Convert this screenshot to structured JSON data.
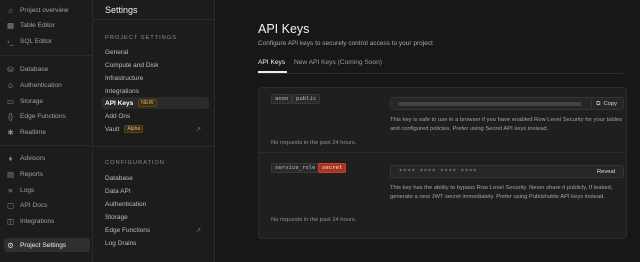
{
  "nav": {
    "items": [
      {
        "label": "Project overview",
        "icon": "home-icon",
        "glyph": "⌂"
      },
      {
        "label": "Table Editor",
        "icon": "table-icon",
        "glyph": "▦"
      },
      {
        "label": "SQL Editor",
        "icon": "terminal-icon",
        "glyph": "›_"
      },
      {
        "label": "Database",
        "icon": "database-icon",
        "glyph": "⛁"
      },
      {
        "label": "Authentication",
        "icon": "users-icon",
        "glyph": "☺"
      },
      {
        "label": "Storage",
        "icon": "archive-icon",
        "glyph": "▭"
      },
      {
        "label": "Edge Functions",
        "icon": "code-icon",
        "glyph": "{}"
      },
      {
        "label": "Realtime",
        "icon": "realtime-icon",
        "glyph": "✱"
      },
      {
        "label": "Advisors",
        "icon": "lightbulb-icon",
        "glyph": "♦"
      },
      {
        "label": "Reports",
        "icon": "chart-icon",
        "glyph": "▤"
      },
      {
        "label": "Logs",
        "icon": "list-icon",
        "glyph": "≡"
      },
      {
        "label": "API Docs",
        "icon": "docs-icon",
        "glyph": "▢"
      },
      {
        "label": "Integrations",
        "icon": "integrations-icon",
        "glyph": "◫"
      },
      {
        "label": "Project Settings",
        "icon": "gear-icon",
        "glyph": "⚙"
      }
    ]
  },
  "settings": {
    "title": "Settings",
    "project_section": "PROJECT SETTINGS",
    "project_items": [
      "General",
      "Compute and Disk",
      "Infrastructure",
      "Integrations",
      "API Keys",
      "Add Ons",
      "Vault"
    ],
    "new_badge": "NEW",
    "alpha_badge": "Alpha",
    "config_section": "CONFIGURATION",
    "config_items": [
      "Database",
      "Data API",
      "Authentication",
      "Storage",
      "Edge Functions",
      "Log Drains"
    ]
  },
  "main": {
    "title": "API Keys",
    "description": "Configure API keys to securely control access to your project",
    "tabs": [
      "API Keys",
      "New API Keys (Coming Soon)"
    ],
    "anon": {
      "tags": [
        "anon",
        "public"
      ],
      "copy_label": "Copy",
      "help": "This key is safe to use in a browser if you have enabled Row Level Security for your tables and configured policies. Prefer using Secret API keys instead.",
      "requests": "No requests in the past 24 hours."
    },
    "service": {
      "tags": [
        "service_role",
        "secret"
      ],
      "masked": "**** **** **** ****",
      "reveal_label": "Reveal",
      "help": "This key has the ability to bypass Row Level Security. Never share it publicly. If leaked, generate a new JWT secret immediately. Prefer using Publishable API keys instead.",
      "requests": "No requests in the past 24 hours."
    }
  },
  "colors": {
    "accent_badge": "#e7b35b",
    "secret_tag": "#a8331f",
    "background": "#171717"
  }
}
